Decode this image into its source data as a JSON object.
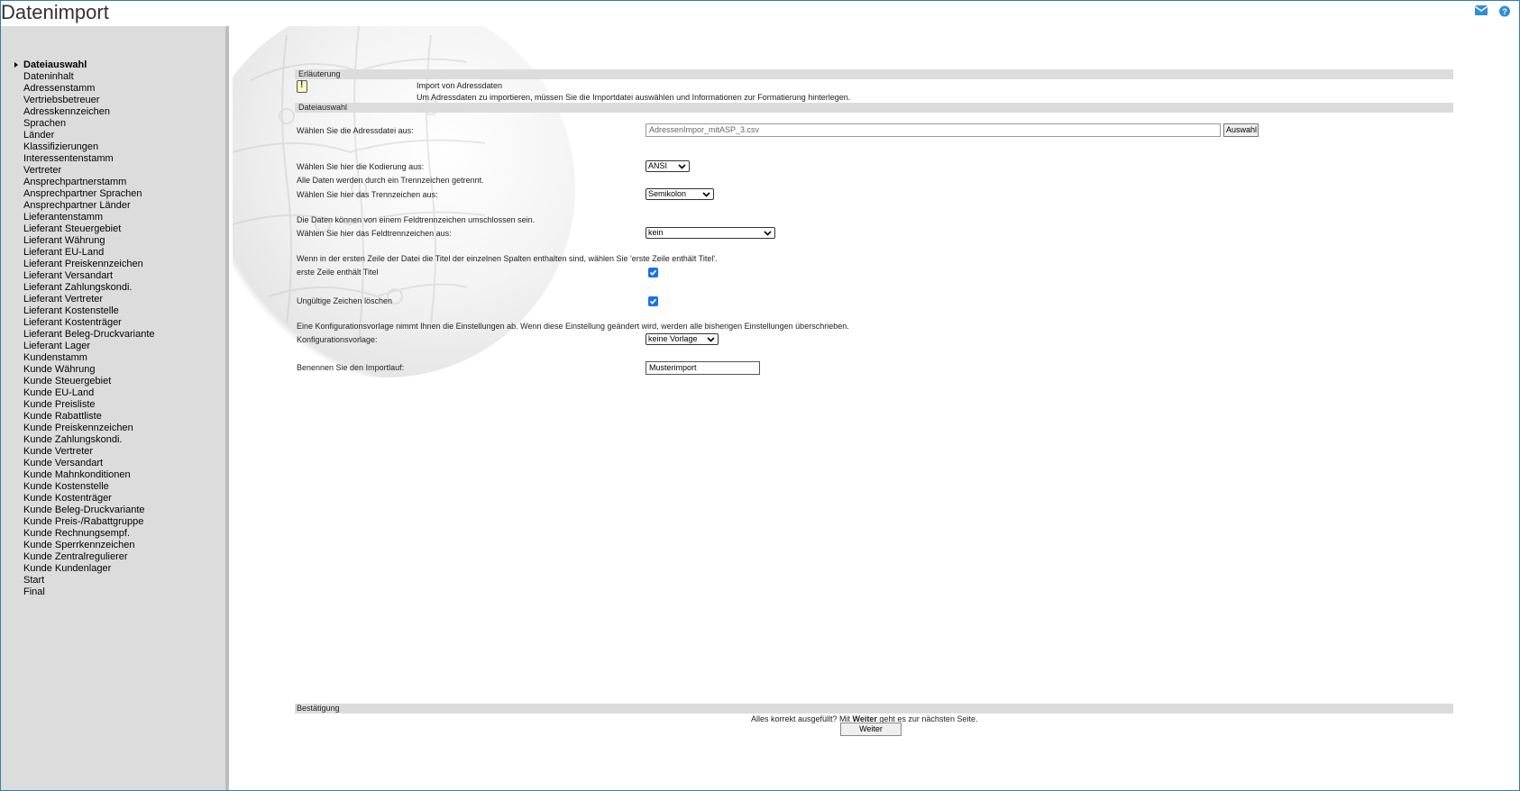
{
  "window": {
    "title": "Datenimport"
  },
  "icons": {
    "mail": "mail-icon",
    "help": "help-icon"
  },
  "sidebar": {
    "items": [
      "Dateiauswahl",
      "Dateninhalt",
      "Adressenstamm",
      "Vertriebsbetreuer",
      "Adresskennzeichen",
      "Sprachen",
      "Länder",
      "Klassifizierungen",
      "Interessentenstamm",
      "Vertreter",
      "Ansprechpartnerstamm",
      "Ansprechpartner Sprachen",
      "Ansprechpartner Länder",
      "Lieferantenstamm",
      "Lieferant Steuergebiet",
      "Lieferant Währung",
      "Lieferant EU-Land",
      "Lieferant Preiskennzeichen",
      "Lieferant Versandart",
      "Lieferant Zahlungskondi.",
      "Lieferant Vertreter",
      "Lieferant Kostenstelle",
      "Lieferant Kostenträger",
      "Lieferant Beleg-Druckvariante",
      "Lieferant Lager",
      "Kundenstamm",
      "Kunde Währung",
      "Kunde Steuergebiet",
      "Kunde EU-Land",
      "Kunde Preisliste",
      "Kunde Rabattliste",
      "Kunde Preiskennzeichen",
      "Kunde Zahlungskondi.",
      "Kunde Vertreter",
      "Kunde Versandart",
      "Kunde Mahnkonditionen",
      "Kunde Kostenstelle",
      "Kunde Kostenträger",
      "Kunde Beleg-Druckvariante",
      "Kunde Preis-/Rabattgruppe",
      "Kunde Rechnungsempf.",
      "Kunde Sperrkennzeichen",
      "Kunde Zentralregulierer",
      "Kunde Kundenlager",
      "Start",
      "Final"
    ],
    "active_index": 0
  },
  "explanation": {
    "section_label": "Erläuterung",
    "heading": "Import von Adressdaten",
    "text": "Um Adressdaten zu importieren, müssen Sie die Importdatei auswählen und Informationen zur Formatierung hinterlegen."
  },
  "file_selection": {
    "section_label": "Dateiauswahl",
    "file_label": "Wählen Sie die Adressdatei aus:",
    "file_value": "AdressenImpor_mitASP_3.csv",
    "browse_label": "Auswahl",
    "encoding_label": "Wählen Sie hier die Kodierung aus:",
    "encoding_value": "ANSI",
    "delimiter_note": "Alle Daten werden durch ein Trennzeichen getrennt.",
    "delimiter_label": "Wählen Sie hier das Trennzeichen aus:",
    "delimiter_value": "Semikolon",
    "enclosure_note": "Die Daten können von einem Feldtrennzeichen umschlossen sein.",
    "enclosure_label": "Wählen Sie hier das Feldtrennzeichen aus:",
    "enclosure_value": "kein",
    "header_note": "Wenn in der ersten Zeile der Datei die Titel der einzelnen Spalten enthalten sind, wählen Sie 'erste Zeile enthält Titel'.",
    "header_label": "erste Zeile enthält Titel",
    "header_checked": true,
    "invalid_label": "Ungültige Zeichen löschen",
    "invalid_checked": true,
    "template_note": "Eine Konfigurationsvorlage nimmt Ihnen die Einstellungen ab. Wenn diese Einstellung geändert wird, werden alle bisherigen Einstellungen überschrieben.",
    "template_label": "Konfigurationsvorlage:",
    "template_value": "keine Vorlage",
    "name_label": "Benennen Sie den Importlauf:",
    "name_value": "Musterimport"
  },
  "confirmation": {
    "section_label": "Bestätigung",
    "text_before": "Alles korrekt ausgefüllt?  Mit ",
    "text_bold": "Weiter",
    "text_after": " geht es zur nächsten Seite.",
    "next_label": "Weiter"
  }
}
